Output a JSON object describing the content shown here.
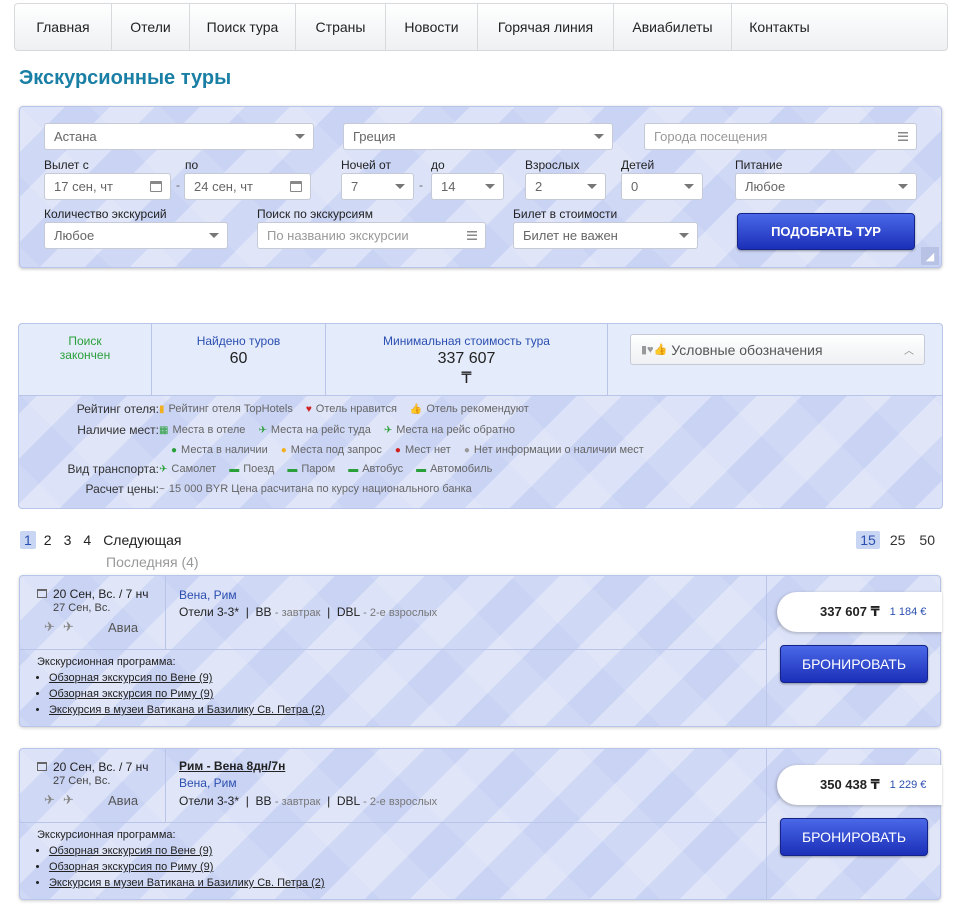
{
  "nav": {
    "items": [
      "Главная",
      "Отели",
      "Поиск тура",
      "Страны",
      "Новости",
      "Горячая линия",
      "Авиабилеты",
      "Контакты"
    ]
  },
  "page": {
    "title": "Экскурсионные туры"
  },
  "search": {
    "departure_city": "Астана",
    "country": "Греция",
    "cities_placeholder": "Города посещения",
    "labels": {
      "departure": "Вылет с",
      "to": "по",
      "nights_from": "Ночей от",
      "nights_to": "до",
      "adults": "Взрослых",
      "children": "Детей",
      "meal": "Питание",
      "excursion_count": "Количество экскурсий",
      "excursion_search": "Поиск по экскурсиям",
      "ticket_included": "Билет в стоимости"
    },
    "date_from": "17 сен, чт",
    "date_to": "24 сен, чт",
    "nights_from": "7",
    "nights_to": "14",
    "adults": "2",
    "children": "0",
    "meal": "Любое",
    "excursion_count": "Любое",
    "excursion_search_placeholder": "По названию экскурсии",
    "ticket_included": "Билет не важен",
    "submit_label": "Подобрать тур",
    "dash": "-"
  },
  "summary": {
    "status": "Поиск закончен",
    "found_label": "Найдено туров",
    "found_value": "60",
    "min_price_label": "Минимальная стоимость тура",
    "min_price_value": "337 607",
    "currency": "₸",
    "legend_label": "Условные обозначения"
  },
  "legend": {
    "rows": [
      {
        "label": "Рейтинг отеля:",
        "items": [
          {
            "icon": "trophy-icon",
            "color": "#f0b020",
            "text": "Рейтинг отеля TopHotels"
          },
          {
            "icon": "heart-icon",
            "color": "#d02020",
            "text": "Отель нравится"
          },
          {
            "icon": "thumbs-up-icon",
            "color": "#2aa03a",
            "text": "Отель рекомендуют"
          }
        ]
      },
      {
        "label": "Наличие мест:",
        "items": [
          {
            "icon": "hotel-icon",
            "color": "#2aa03a",
            "text": "Места в отеле"
          },
          {
            "icon": "plane-there-icon",
            "color": "#2aa03a",
            "text": "Места на рейс туда"
          },
          {
            "icon": "plane-back-icon",
            "color": "#2aa03a",
            "text": "Места на рейс обратно"
          }
        ]
      },
      {
        "label": "",
        "items": [
          {
            "icon": "dot-green-icon",
            "color": "#2aa03a",
            "text": "Места в наличии"
          },
          {
            "icon": "dot-yellow-icon",
            "color": "#f0b020",
            "text": "Места под запрос"
          },
          {
            "icon": "dot-red-icon",
            "color": "#d02020",
            "text": "Мест нет"
          },
          {
            "icon": "dot-grey-icon",
            "color": "#999999",
            "text": "Нет информации о наличии мест"
          }
        ]
      },
      {
        "label": "Вид транспорта:",
        "items": [
          {
            "icon": "plane-icon",
            "color": "#2aa03a",
            "text": "Самолет"
          },
          {
            "icon": "train-icon",
            "color": "#2aa03a",
            "text": "Поезд"
          },
          {
            "icon": "ferry-icon",
            "color": "#2aa03a",
            "text": "Паром"
          },
          {
            "icon": "bus-icon",
            "color": "#2aa03a",
            "text": "Автобус"
          },
          {
            "icon": "car-icon",
            "color": "#2aa03a",
            "text": "Автомобиль"
          }
        ]
      },
      {
        "label": "Расчет цены:",
        "items": [
          {
            "icon": "approx-icon",
            "color": "#666666",
            "text": "15 000 BYR Цена расчитана по курсу национального банка"
          }
        ]
      }
    ]
  },
  "pager": {
    "pages": [
      "1",
      "2",
      "3",
      "4"
    ],
    "active": "1",
    "next": "Следующая",
    "last": "Последняя (4)",
    "per_page": [
      "15",
      "25",
      "50"
    ],
    "per_page_active": "15"
  },
  "tours": [
    {
      "date": "20 Сен, Вс. / 7 нч",
      "return_date": "27 Сен, Вс.",
      "transport": "Авиа",
      "name": "",
      "cities": "Вена, Рим",
      "hotel": "Отели 3-3*",
      "meal_code": "BB",
      "meal_name": "завтрак",
      "room_code": "DBL",
      "room_name": "2-е взрослых",
      "program_label": "Экскурсионная программа:",
      "excursions": [
        "Обзорная экскурсия по Вене (9)",
        "Обзорная экскурсия по Риму (9)",
        "Экскурсия в музеи Ватикана и Базилику Св. Петра (2)"
      ],
      "price": "337 607 ₸",
      "price_eur": "1 184 €",
      "book_label": "Бронировать"
    },
    {
      "date": "20 Сен, Вс. / 7 нч",
      "return_date": "27 Сен, Вс.",
      "transport": "Авиа",
      "name": "Рим - Вена 8дн/7н",
      "cities": "Вена, Рим",
      "hotel": "Отели 3-3*",
      "meal_code": "BB",
      "meal_name": "завтрак",
      "room_code": "DBL",
      "room_name": "2-е взрослых",
      "program_label": "Экскурсионная программа:",
      "excursions": [
        "Обзорная экскурсия по Вене (9)",
        "Обзорная экскурсия по Риму (9)",
        "Экскурсия в музеи Ватикана и Базилику Св. Петра (2)"
      ],
      "price": "350 438 ₸",
      "price_eur": "1 229 €",
      "book_label": "Бронировать"
    }
  ],
  "colors": {
    "accent": "#1a7fa5",
    "link": "#2b4fb0",
    "button": "#1b2fb8",
    "success": "#2aa03a"
  }
}
